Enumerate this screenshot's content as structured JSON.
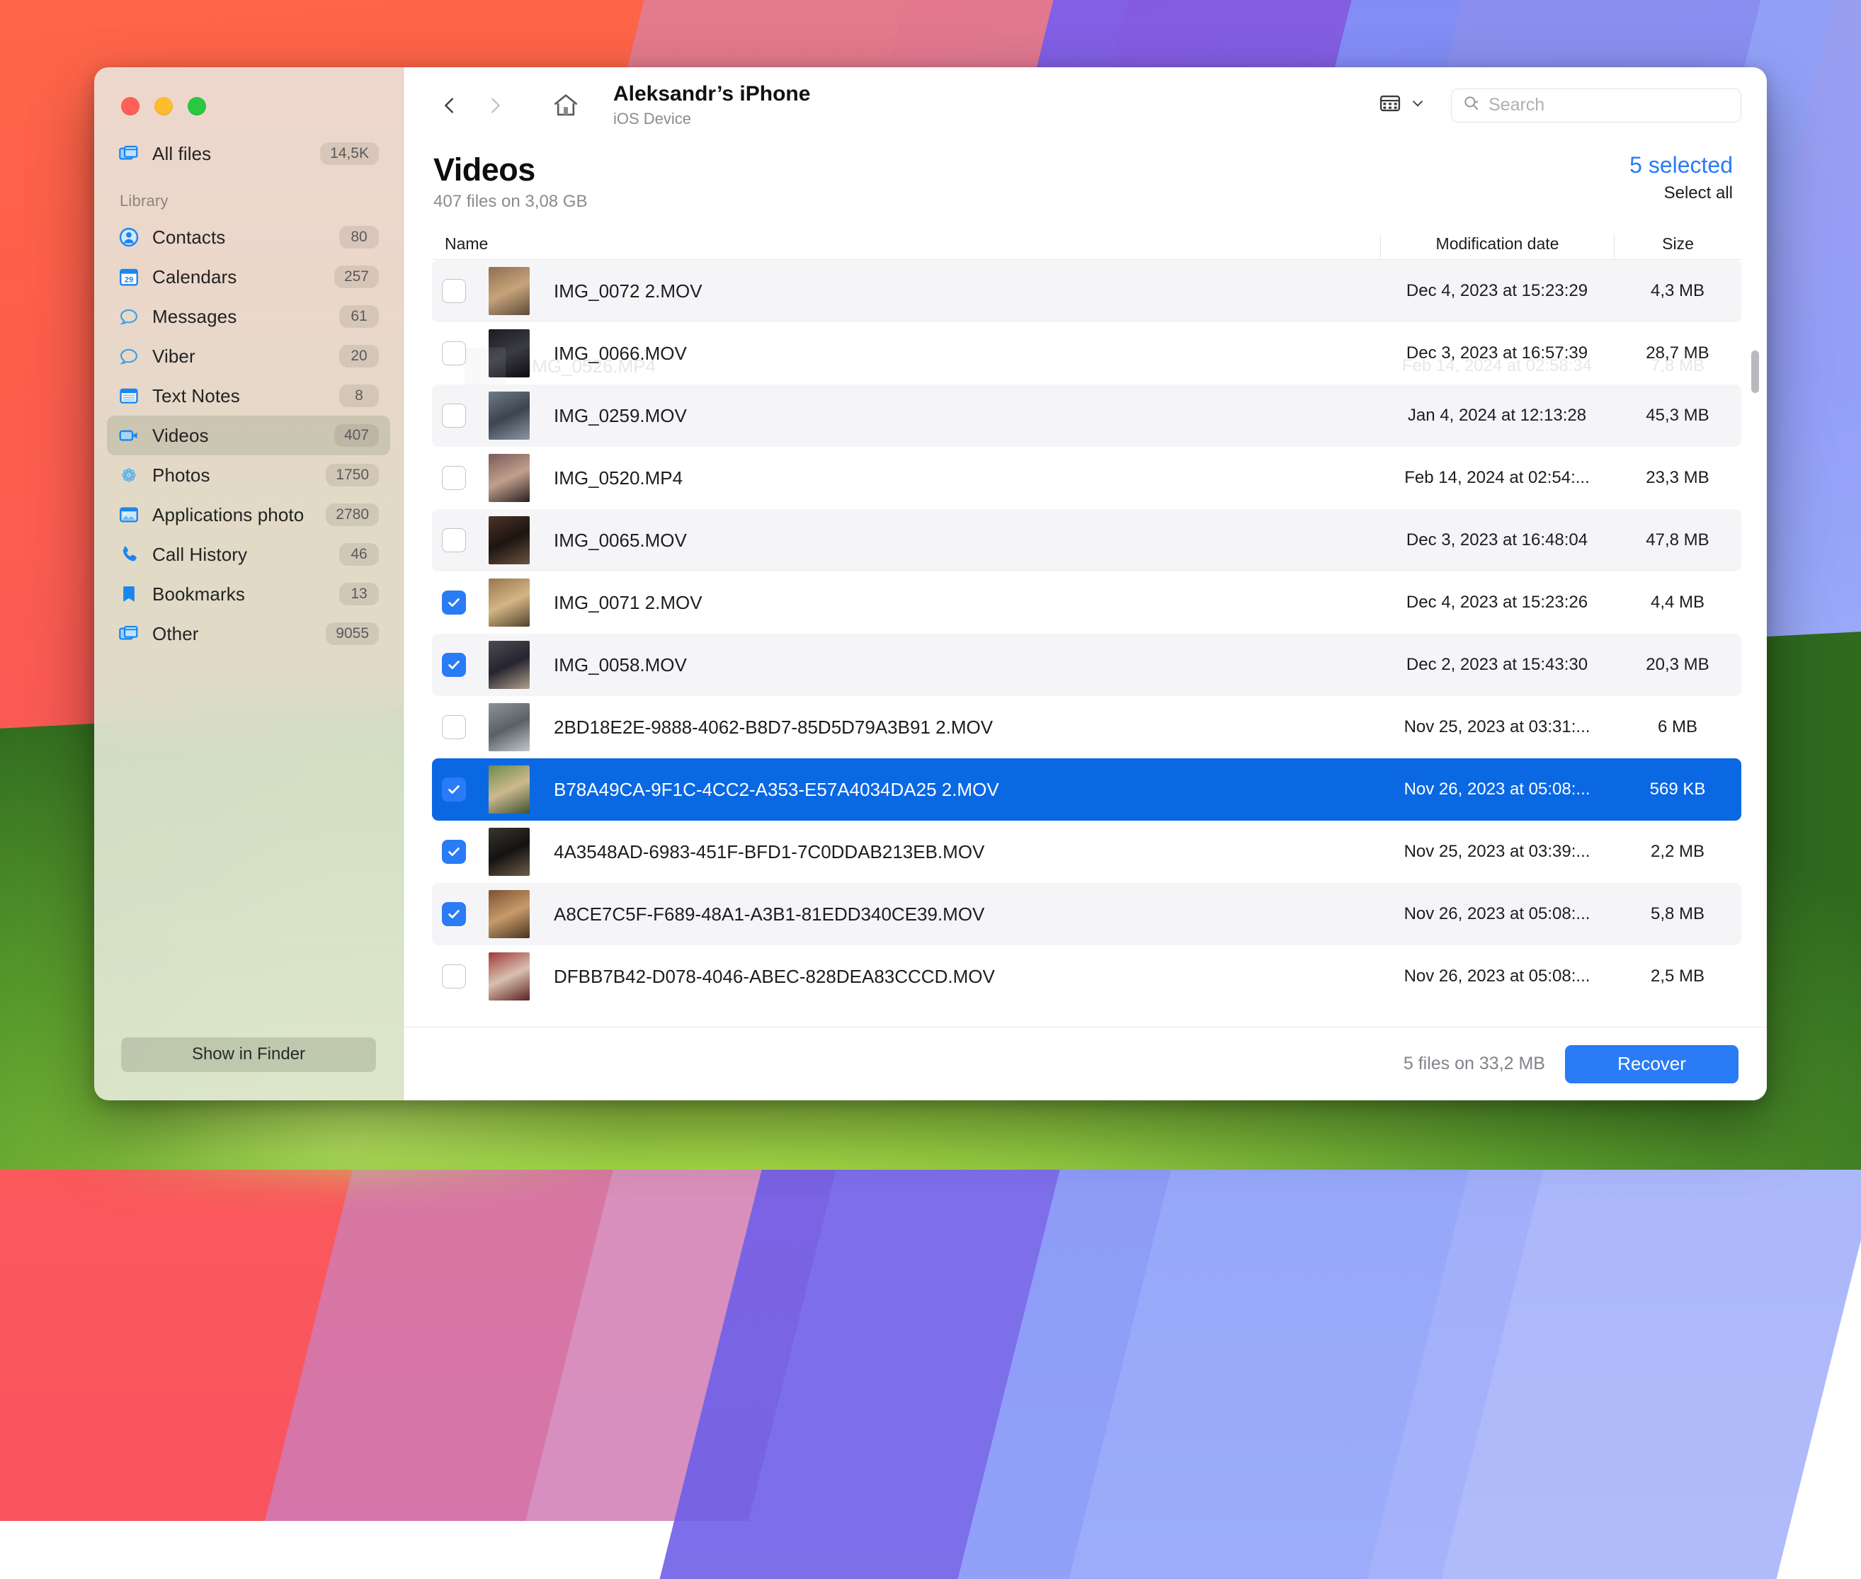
{
  "window": {
    "traffic_lights": [
      "close",
      "minimize",
      "zoom"
    ]
  },
  "sidebar": {
    "all_files": {
      "label": "All files",
      "count": "14,5K",
      "icon": "stacked-windows-icon"
    },
    "library_header": "Library",
    "items": [
      {
        "label": "Contacts",
        "count": "80",
        "icon": "contact-icon"
      },
      {
        "label": "Calendars",
        "count": "257",
        "icon": "calendar-icon"
      },
      {
        "label": "Messages",
        "count": "61",
        "icon": "message-bubble-icon"
      },
      {
        "label": "Viber",
        "count": "20",
        "icon": "message-bubble-icon"
      },
      {
        "label": "Text Notes",
        "count": "8",
        "icon": "notes-icon"
      },
      {
        "label": "Videos",
        "count": "407",
        "icon": "video-camera-icon",
        "active": true
      },
      {
        "label": "Photos",
        "count": "1750",
        "icon": "photos-flower-icon"
      },
      {
        "label": "Applications photo",
        "count": "2780",
        "icon": "picture-frame-icon"
      },
      {
        "label": "Call History",
        "count": "46",
        "icon": "phone-icon"
      },
      {
        "label": "Bookmarks",
        "count": "13",
        "icon": "bookmark-icon"
      },
      {
        "label": "Other",
        "count": "9055",
        "icon": "stacked-windows-icon"
      }
    ],
    "show_in_finder": "Show in Finder"
  },
  "toolbar": {
    "back_icon": "chevron-left-icon",
    "forward_icon": "chevron-right-icon",
    "home_icon": "home-icon",
    "device_title": "Aleksandr’s iPhone",
    "device_subtitle": "iOS Device",
    "view_icon": "list-view-icon",
    "view_chevron_icon": "chevron-down-icon",
    "search_icon": "search-icon",
    "search_value": "",
    "search_placeholder": "Search"
  },
  "page": {
    "title": "Videos",
    "subtitle": "407 files on 3,08 GB",
    "selected_label": "5 selected",
    "select_all_label": "Select all"
  },
  "columns": {
    "name": "Name",
    "modification_date": "Modification date",
    "size": "Size"
  },
  "ghost_row": {
    "name": "IMG_0526.MP4",
    "date": "Feb 14, 2024 at 02:58:34",
    "size": "7,8 MB"
  },
  "files": [
    {
      "name": "IMG_0072 2.MOV",
      "date": "Dec 4, 2023 at 15:23:29",
      "size": "4,3 MB",
      "checked": false,
      "highlighted": false,
      "thumb": [
        "#8e6f52",
        "#c7a37a",
        "#5c4a3a"
      ]
    },
    {
      "name": "IMG_0066.MOV",
      "date": "Dec 3, 2023 at 16:57:39",
      "size": "28,7 MB",
      "checked": false,
      "highlighted": false,
      "thumb": [
        "#1a1a1e",
        "#3b3b44",
        "#0c0c10"
      ]
    },
    {
      "name": "IMG_0259.MOV",
      "date": "Jan 4, 2024 at 12:13:28",
      "size": "45,3 MB",
      "checked": false,
      "highlighted": false,
      "thumb": [
        "#6f7a86",
        "#3c4450",
        "#8d97a3"
      ]
    },
    {
      "name": "IMG_0520.MP4",
      "date": "Feb 14, 2024 at 02:54:...",
      "size": "23,3 MB",
      "checked": false,
      "highlighted": false,
      "thumb": [
        "#7a5a58",
        "#c0a08c",
        "#2a2020"
      ]
    },
    {
      "name": "IMG_0065.MOV",
      "date": "Dec 3, 2023 at 16:48:04",
      "size": "47,8 MB",
      "checked": false,
      "highlighted": false,
      "thumb": [
        "#4a3428",
        "#1d1410",
        "#6b5340"
      ]
    },
    {
      "name": "IMG_0071 2.MOV",
      "date": "Dec 4, 2023 at 15:23:26",
      "size": "4,4 MB",
      "checked": true,
      "highlighted": false,
      "thumb": [
        "#95774f",
        "#d4b584",
        "#52412c"
      ]
    },
    {
      "name": "IMG_0058.MOV",
      "date": "Dec 2, 2023 at 15:43:30",
      "size": "20,3 MB",
      "checked": true,
      "highlighted": false,
      "thumb": [
        "#4e4a52",
        "#262430",
        "#b0a08c"
      ]
    },
    {
      "name": "2BD18E2E-9888-4062-B8D7-85D5D79A3B91 2.MOV",
      "date": "Nov 25, 2023 at 03:31:...",
      "size": "6 MB",
      "checked": false,
      "highlighted": false,
      "thumb": [
        "#8d9398",
        "#5a6065",
        "#c2c7cb"
      ]
    },
    {
      "name": "B78A49CA-9F1C-4CC2-A353-E57A4034DA25 2.MOV",
      "date": "Nov 26, 2023 at 05:08:...",
      "size": "569 KB",
      "checked": true,
      "highlighted": true,
      "thumb": [
        "#6f8a4a",
        "#cdb98f",
        "#3d5230"
      ]
    },
    {
      "name": "4A3548AD-6983-451F-BFD1-7C0DDAB213EB.MOV",
      "date": "Nov 25, 2023 at 03:39:...",
      "size": "2,2 MB",
      "checked": true,
      "highlighted": false,
      "thumb": [
        "#3a3630",
        "#141210",
        "#6d5e4a"
      ]
    },
    {
      "name": "A8CE7C5F-F689-48A1-A3B1-81EDD340CE39.MOV",
      "date": "Nov 26, 2023 at 05:08:...",
      "size": "5,8 MB",
      "checked": true,
      "highlighted": false,
      "thumb": [
        "#7a5230",
        "#c89a6a",
        "#46341f"
      ]
    },
    {
      "name": "DFBB7B42-D078-4046-ABEC-828DEA83CCCD.MOV",
      "date": "Nov 26, 2023 at 05:08:...",
      "size": "2,5 MB",
      "checked": false,
      "highlighted": false,
      "thumb": [
        "#a03a3a",
        "#d8c0b0",
        "#5c2020"
      ]
    }
  ],
  "bottom": {
    "info": "5 files on 33,2 MB",
    "recover_label": "Recover"
  },
  "colors": {
    "accent": "#2a7bf6",
    "selection_row": "#0b68e3",
    "sidebar_icon": "#1a86f0"
  }
}
